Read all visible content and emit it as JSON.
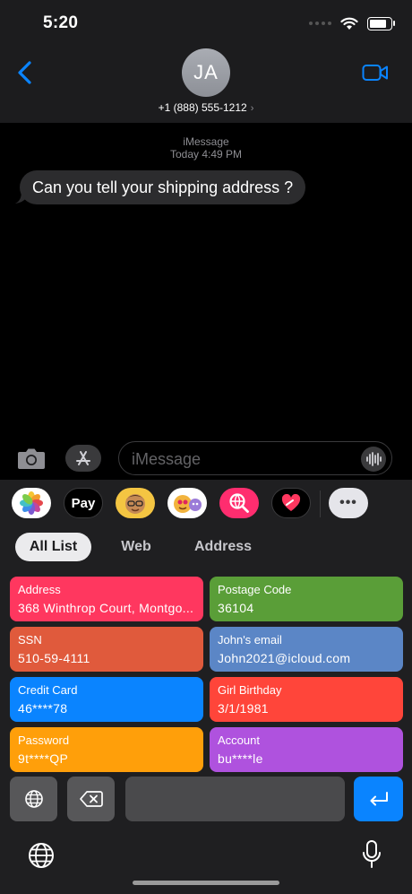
{
  "status_bar": {
    "time": "5:20"
  },
  "header": {
    "avatar_initials": "JA",
    "contact_label": "+1 (888) 555-1212",
    "chevron": "›"
  },
  "conversation": {
    "service": "iMessage",
    "timestamp": "Today 4:49 PM",
    "messages": [
      {
        "text": "Can you tell your shipping address ?"
      }
    ]
  },
  "composer": {
    "placeholder": "iMessage"
  },
  "app_strip": {
    "apps": [
      "photos-app-icon",
      "apple-pay-app-icon",
      "memoji-app-icon",
      "animoji-app-icon",
      "search-images-app-icon",
      "digital-touch-app-icon",
      "more-apps-icon"
    ],
    "pay_label": "Pay",
    "more_label": "•••"
  },
  "tabs": [
    {
      "label": "All List",
      "active": true
    },
    {
      "label": "Web",
      "active": false
    },
    {
      "label": "Address",
      "active": false
    }
  ],
  "cards": [
    {
      "label": "Address",
      "value": "368 Winthrop Court, Montgo...",
      "color": "#ff375f"
    },
    {
      "label": "Postage Code",
      "value": "36104",
      "color": "#5a9e38"
    },
    {
      "label": "SSN",
      "value": "510-59-4111",
      "color": "#e05a3c"
    },
    {
      "label": "John's email",
      "value": "John2021@icloud.com",
      "color": "#5b86c6"
    },
    {
      "label": "Credit Card",
      "value": "46****78",
      "color": "#0a84ff"
    },
    {
      "label": "Girl Birthday",
      "value": "3/1/1981",
      "color": "#ff453a"
    },
    {
      "label": "Password",
      "value": "9t****QP",
      "color": "#ff9f0a"
    },
    {
      "label": "Account",
      "value": "bu****le",
      "color": "#af52de"
    }
  ],
  "colors": {
    "accent": "#0a84ff",
    "header_bg": "#1c1c1e",
    "keyboard_bg": "#1f1f21",
    "bubble_bg": "#2c2c2e"
  }
}
